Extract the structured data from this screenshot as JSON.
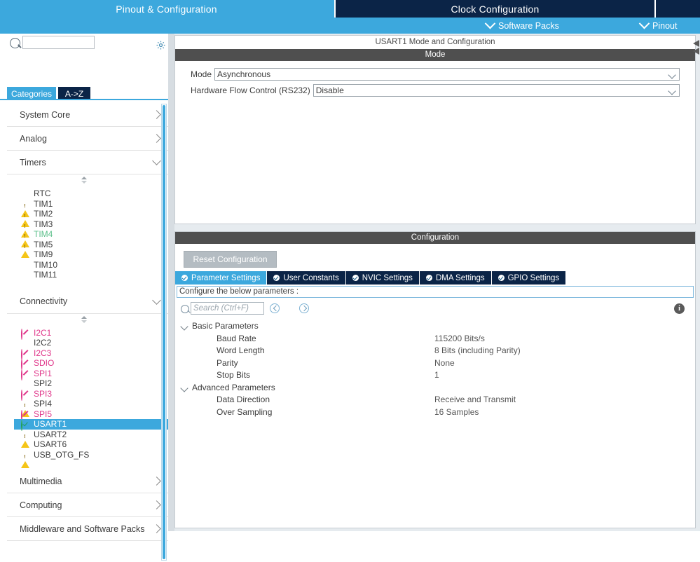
{
  "topbar": {
    "tabs": [
      {
        "label": "Pinout & Configuration",
        "state": "active"
      },
      {
        "label": "Clock Configuration",
        "state": "inactive"
      }
    ],
    "subbar": [
      {
        "label": "Software Packs",
        "icon": "chevron-down-icon"
      },
      {
        "label": "Pinout",
        "icon": "chevron-down-icon"
      }
    ]
  },
  "sidebar": {
    "search": {
      "value": "",
      "placeholder": ""
    },
    "gear_icon": "gear-icon",
    "tabs": [
      {
        "label": "Categories",
        "state": "active"
      },
      {
        "label": "A->Z",
        "state": "inactive"
      }
    ],
    "categories": [
      {
        "label": "System Core",
        "expanded": false
      },
      {
        "label": "Analog",
        "expanded": false
      },
      {
        "label": "Timers",
        "expanded": true
      },
      {
        "label": "Connectivity",
        "expanded": true
      },
      {
        "label": "Multimedia",
        "expanded": false
      },
      {
        "label": "Computing",
        "expanded": false
      },
      {
        "label": "Middleware and Software Packs",
        "expanded": false
      }
    ],
    "timers_items": [
      {
        "label": "RTC",
        "icon": "none",
        "color": "default"
      },
      {
        "label": "TIM1",
        "icon": "warning-icon",
        "color": "default"
      },
      {
        "label": "TIM2",
        "icon": "warning-icon",
        "color": "default"
      },
      {
        "label": "TIM3",
        "icon": "warning-icon",
        "color": "default"
      },
      {
        "label": "TIM4",
        "icon": "warning-icon",
        "color": "green"
      },
      {
        "label": "TIM5",
        "icon": "warning-icon",
        "color": "default"
      },
      {
        "label": "TIM9",
        "icon": "none",
        "color": "default"
      },
      {
        "label": "TIM10",
        "icon": "none",
        "color": "default"
      },
      {
        "label": "TIM11",
        "icon": "none",
        "color": "default"
      }
    ],
    "connectivity_items": [
      {
        "label": "I2C1",
        "icon": "forbidden-icon",
        "color": "pink",
        "selected": false
      },
      {
        "label": "I2C2",
        "icon": "none",
        "color": "default",
        "selected": false
      },
      {
        "label": "I2C3",
        "icon": "forbidden-icon",
        "color": "pink",
        "selected": false
      },
      {
        "label": "SDIO",
        "icon": "forbidden-icon",
        "color": "pink",
        "selected": false
      },
      {
        "label": "SPI1",
        "icon": "forbidden-icon",
        "color": "pink",
        "selected": false
      },
      {
        "label": "SPI2",
        "icon": "none",
        "color": "default",
        "selected": false
      },
      {
        "label": "SPI3",
        "icon": "forbidden-icon",
        "color": "pink",
        "selected": false
      },
      {
        "label": "SPI4",
        "icon": "warning-icon",
        "color": "default",
        "selected": false
      },
      {
        "label": "SPI5",
        "icon": "forbidden-icon",
        "color": "pink",
        "selected": false
      },
      {
        "label": "USART1",
        "icon": "check-icon",
        "color": "default",
        "selected": true
      },
      {
        "label": "USART2",
        "icon": "warning-icon",
        "color": "default",
        "selected": false
      },
      {
        "label": "USART6",
        "icon": "none",
        "color": "default",
        "selected": false
      },
      {
        "label": "USB_OTG_FS",
        "icon": "warning-icon",
        "color": "default",
        "selected": false
      }
    ]
  },
  "mode_panel": {
    "title": "USART1 Mode and Configuration",
    "section_label": "Mode",
    "fields": [
      {
        "label": "Mode",
        "value": "Asynchronous"
      },
      {
        "label": "Hardware Flow Control (RS232)",
        "value": "Disable"
      }
    ]
  },
  "config_panel": {
    "title": "Configuration",
    "reset_button": "Reset Configuration",
    "tabs": [
      {
        "label": "Parameter Settings",
        "state": "active"
      },
      {
        "label": "User Constants",
        "state": "inactive"
      },
      {
        "label": "NVIC Settings",
        "state": "inactive"
      },
      {
        "label": "DMA Settings",
        "state": "inactive"
      },
      {
        "label": "GPIO Settings",
        "state": "inactive"
      }
    ],
    "note": "Configure the below parameters :",
    "search": {
      "value": "",
      "placeholder": "Search (Ctrl+F)"
    },
    "nav_prev_icon": "chevron-left-circle-icon",
    "nav_next_icon": "chevron-right-circle-icon",
    "info_icon": "info-icon",
    "info_label": "i",
    "groups": [
      {
        "label": "Basic Parameters",
        "expanded": true,
        "params": [
          {
            "name": "Baud Rate",
            "value": "115200 Bits/s"
          },
          {
            "name": "Word Length",
            "value": "8 Bits (including Parity)"
          },
          {
            "name": "Parity",
            "value": "None"
          },
          {
            "name": "Stop Bits",
            "value": "1"
          }
        ]
      },
      {
        "label": "Advanced Parameters",
        "expanded": true,
        "params": [
          {
            "name": "Data Direction",
            "value": "Receive and Transmit"
          },
          {
            "name": "Over Sampling",
            "value": "16 Samples"
          }
        ]
      }
    ]
  },
  "colors": {
    "accent_blue": "#3ca8dd",
    "dark_navy": "#0b2447",
    "warning_yellow": "#f5c518",
    "forbidden_pink": "#e0368a",
    "ok_green": "#1f9f5a",
    "panel_gray": "#4f4f4f"
  }
}
